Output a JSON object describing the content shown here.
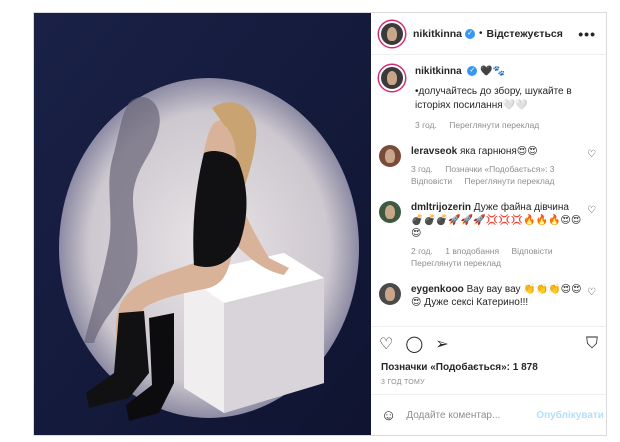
{
  "post": {
    "username": "nikitkinna",
    "follow_label": "Відстежується",
    "dot": "•",
    "more": "•••"
  },
  "caption": {
    "username": "nikitkinna",
    "emojis": "🖤🐾",
    "text": "•долучайтесь до збору, шукайте в історіях посилання🤍🤍",
    "time": "3 год.",
    "translate": "Переглянути переклад"
  },
  "comments": [
    {
      "username": "leravseok",
      "text": "яка гарнюня😍😍",
      "time": "3 год.",
      "likes": "Позначки «Подобається»: 3",
      "reply": "Відповісти",
      "translate": "Переглянути переклад"
    },
    {
      "username": "dmltrijozerin",
      "text": "Дуже файна дівчина 💣💣💣🚀🚀🚀💢💢💢🔥🔥🔥😍😍😍",
      "time": "2 год.",
      "likes": "1 вподобання",
      "reply": "Відповісти",
      "translate": "Переглянути переклад"
    },
    {
      "username": "eygenkooo",
      "text": "Вау вау вау 👏👏👏😍😍😍 Дуже сексі Катерино!!!"
    }
  ],
  "likes_count": "Позначки «Подобається»: 1 878",
  "timestamp": "3 ГОД ТОМУ",
  "add_comment": {
    "placeholder": "Додайте коментар...",
    "publish": "Опублікувати"
  },
  "colors": {
    "accent": "#3897f0",
    "publish_disabled": "#b2dffc",
    "photo_bg": "#1c2345"
  },
  "icons": [
    "heart-icon",
    "comment-icon",
    "share-icon",
    "bookmark-icon",
    "emoji-icon",
    "verified-icon",
    "more-icon"
  ]
}
